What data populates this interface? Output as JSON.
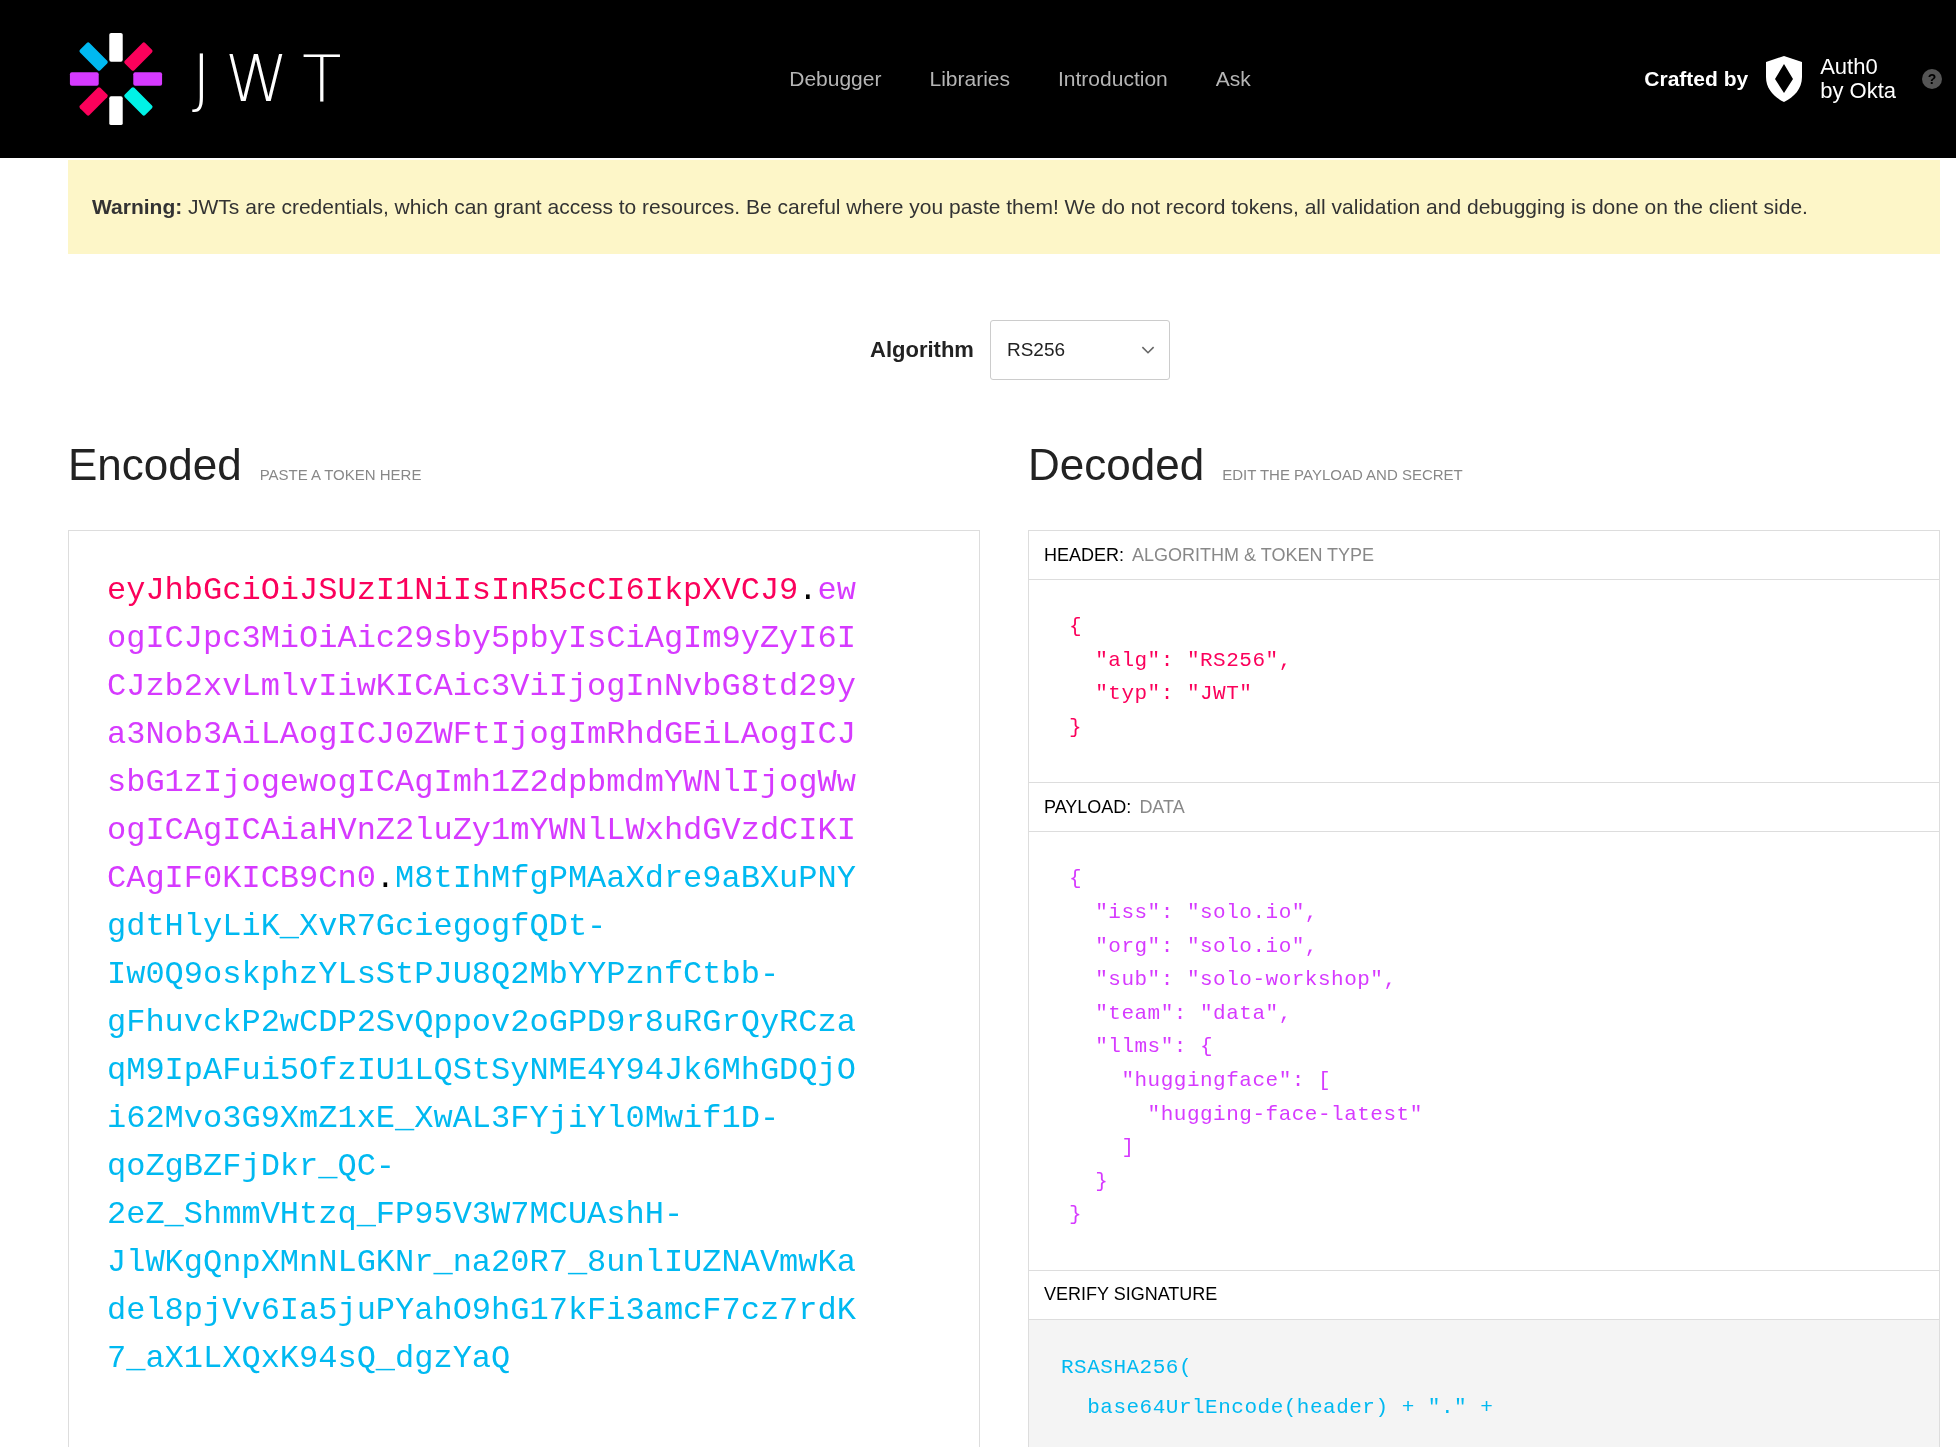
{
  "nav": {
    "logo_text": "JWT",
    "links": [
      "Debugger",
      "Libraries",
      "Introduction",
      "Ask"
    ],
    "crafted_by": "Crafted by",
    "brand": [
      "Auth0",
      "by Okta"
    ],
    "help": "?"
  },
  "warning": "**Warning:** JWTs are credentials, which can grant access to resources. Be careful where you paste them! We do not record tokens, all validation and debugging is done on the client side.",
  "algorithm": {
    "label": "Algorithm",
    "value": "RS256"
  },
  "encoded": {
    "title": "Encoded",
    "hint": "PASTE A TOKEN HERE",
    "token": [
      {
        "kind": "header",
        "text": "eyJhbGciOiJSUzI1NiIsInR5cCI6IkpXVCJ9"
      },
      {
        "kind": "dot",
        "text": "."
      },
      {
        "kind": "payload",
        "text": "ewogICJpc3MiOiAic29sby5pbyIsCiAgIm9yZyI6ICJzb2xvLmlvIiwKICAic3ViIjogInNvbG8td29ya3Nob3AiLAogICJ0ZWFtIjogImRhdGEiLAogICJsbG1zIjogewogICAgImh1Z2dpbmdmYWNlIjogWwogICAgICAiaHVnZ2luZy1mYWNlLWxhdGVzdCIKICAgIF0KICB9Cn0"
      },
      {
        "kind": "dot",
        "text": "."
      },
      {
        "kind": "signature",
        "text": "M8tIhMfgPMAaXdre9aBXuPNYgdtHlyLiK_XvR7GciegogfQDt-Iw0Q9oskphzYLsStPJU8Q2MbYYPznfCtbb-gFhuvckP2wCDP2SvQppov2oGPD9r8uRGrQyRCzaqM9IpAFui5OfzIU1LQStSyNME4Y94Jk6MhGDQjOi62Mvo3G9XmZ1xE_XwAL3FYjiYl0Mwif1D-qoZgBZFjDkr_QC-2eZ_ShmmVHtzq_FP95V3W7MCUAshH-JlWKgQnpXMnNLGKNr_na20R7_8unlIUZNAVmwKadel8pjVv6Ia5juPYahO9hG17kFi3amcF7cz7rdK7_aX1LXQxK94sQ_dgzYaQ"
      }
    ]
  },
  "decoded": {
    "title": "Decoded",
    "hint": "EDIT THE PAYLOAD AND SECRET",
    "sections": [
      {
        "kind": "header",
        "label": "HEADER:",
        "sublabel": "ALGORITHM & TOKEN TYPE",
        "code": "{\n  \"alg\": \"RS256\",\n  \"typ\": \"JWT\"\n}"
      },
      {
        "kind": "payload",
        "label": "PAYLOAD:",
        "sublabel": "DATA",
        "code": "{\n  \"iss\": \"solo.io\",\n  \"org\": \"solo.io\",\n  \"sub\": \"solo-workshop\",\n  \"team\": \"data\",\n  \"llms\": {\n    \"huggingface\": [\n      \"hugging-face-latest\"\n    ]\n  }\n}"
      },
      {
        "kind": "signature",
        "label": "VERIFY SIGNATURE",
        "code": "RSASHA256(\n  base64UrlEncode(header) + \".\" +"
      }
    ]
  }
}
